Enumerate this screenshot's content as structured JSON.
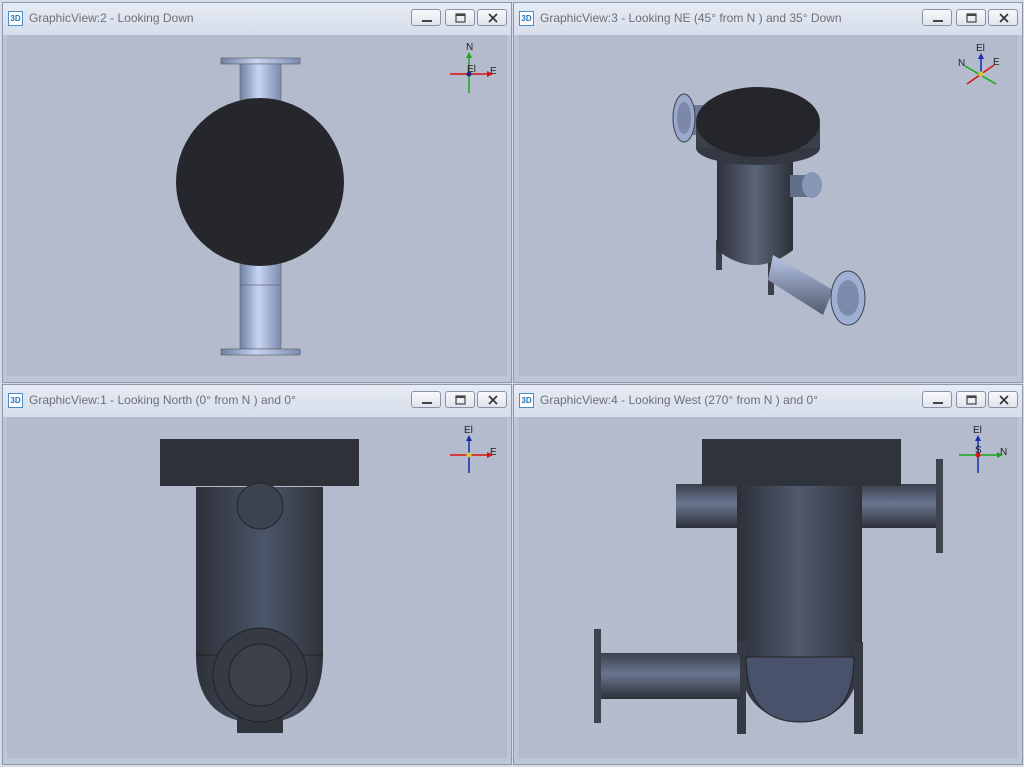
{
  "views": [
    {
      "id": "top-left",
      "title": "GraphicView:2 - Looking Down",
      "axis": {
        "up": "N",
        "right": "E",
        "center": "El"
      }
    },
    {
      "id": "top-right",
      "title": "GraphicView:3 - Looking NE (45° from N ) and 35° Down",
      "axis": {
        "up": "El",
        "right": "E",
        "left": "N"
      }
    },
    {
      "id": "bottom-left",
      "title": "GraphicView:1 - Looking North (0° from N ) and 0°",
      "axis": {
        "up": "El",
        "right": "E"
      }
    },
    {
      "id": "bottom-right",
      "title": "GraphicView:4 - Looking West (270° from N ) and 0°",
      "axis": {
        "up": "El",
        "right": "N",
        "center": "S"
      }
    }
  ],
  "icon_text": "3D",
  "colors": {
    "metal_dark": "#2a2d33",
    "metal_mid": "#4b5568",
    "metal_light": "#aebfe0",
    "viewport": "#b3bbcc"
  }
}
